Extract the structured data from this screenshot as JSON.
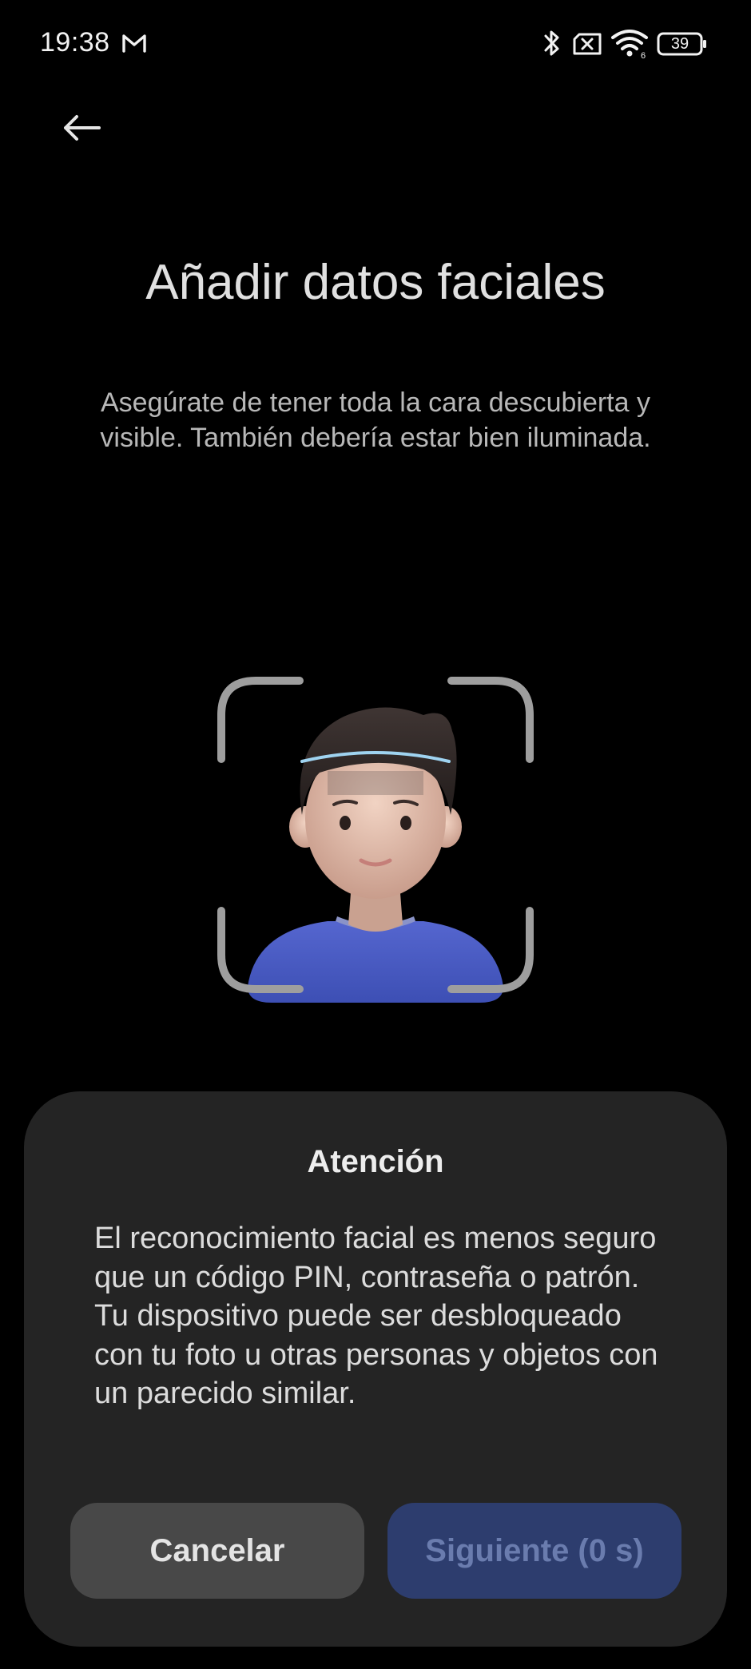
{
  "status_bar": {
    "time": "19:38",
    "battery": "39",
    "icons": [
      "gmail-icon",
      "bluetooth-icon",
      "no-sim-icon",
      "wifi-icon",
      "battery-icon"
    ]
  },
  "header": {
    "back_icon": "arrow-left-icon"
  },
  "main": {
    "title": "Añadir datos faciales",
    "instruction": "Asegúrate de tener toda la cara descubierta y visible. También debería estar bien iluminada.",
    "illustration_icon": "face-scan-avatar-icon"
  },
  "dialog": {
    "title": "Atención",
    "body": "El reconocimiento facial es menos seguro que un código PIN, contraseña o patrón. Tu dispositivo puede ser desbloqueado con tu foto u otras personas y objetos con un parecido similar.",
    "cancel_label": "Cancelar",
    "next_label": "Siguiente (0 s)"
  },
  "colors": {
    "background": "#000000",
    "sheet": "#242424",
    "cancel_button": "#484848",
    "next_button": "#2d3d6e",
    "next_text": "#6a7cae",
    "avatar_shirt": "#4a5cc4",
    "scan_line": "#9fd3f0"
  }
}
